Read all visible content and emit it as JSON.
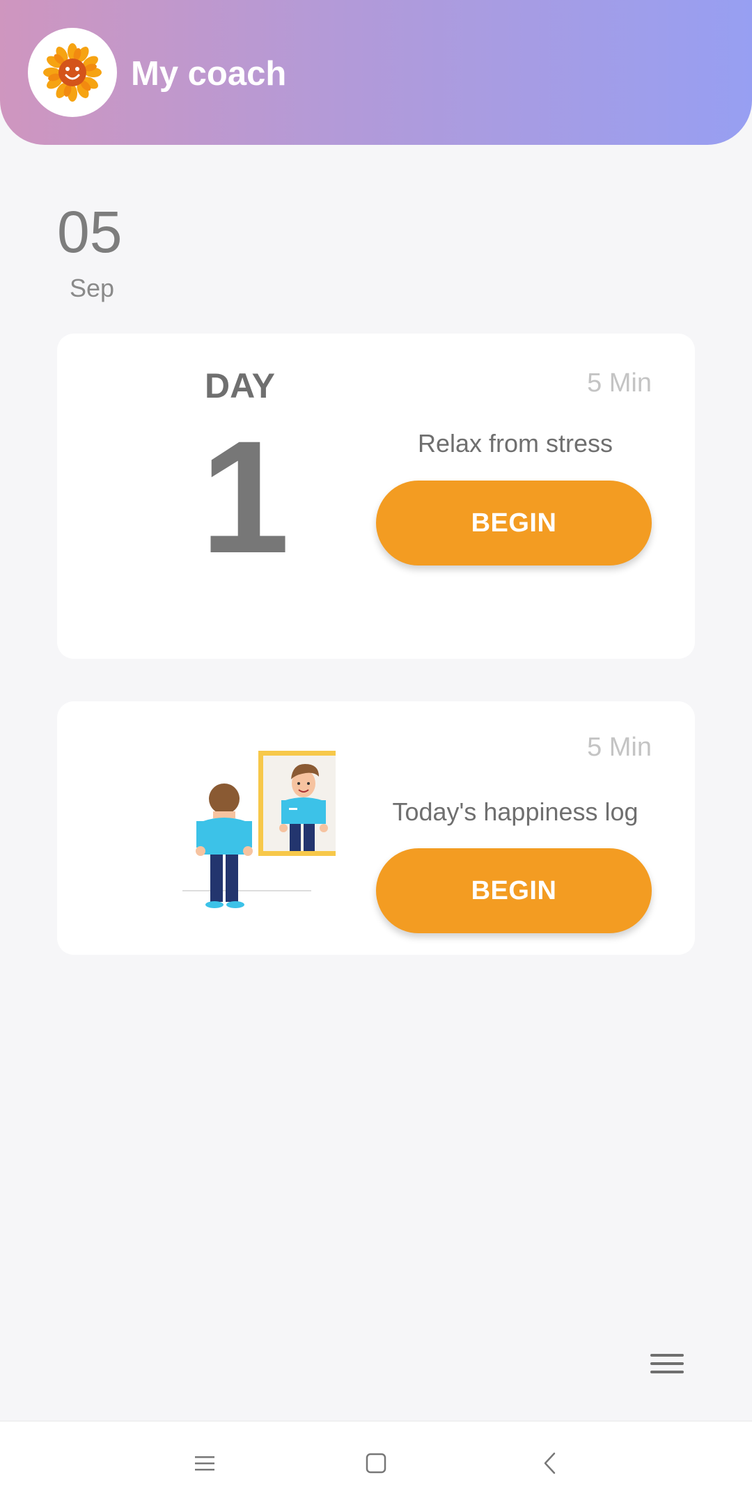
{
  "header": {
    "title": "My coach",
    "logo_icon": "sunflower-icon",
    "gradient": [
      "#cf96bf",
      "#979ff2"
    ]
  },
  "date": {
    "day": "05",
    "month": "Sep"
  },
  "cards": [
    {
      "day_label": "DAY",
      "day_number": "1",
      "duration": "5 Min",
      "title": "Relax from stress",
      "button_label": "BEGIN"
    },
    {
      "illustration": "man-looking-in-mirror",
      "duration": "5 Min",
      "title": "Today's happiness log",
      "button_label": "BEGIN"
    }
  ],
  "accent_color": "#f39c22",
  "floating_menu_icon": "hamburger-menu-icon",
  "navbar": {
    "recents_icon": "recents-icon",
    "home_icon": "home-icon",
    "back_icon": "back-icon"
  }
}
